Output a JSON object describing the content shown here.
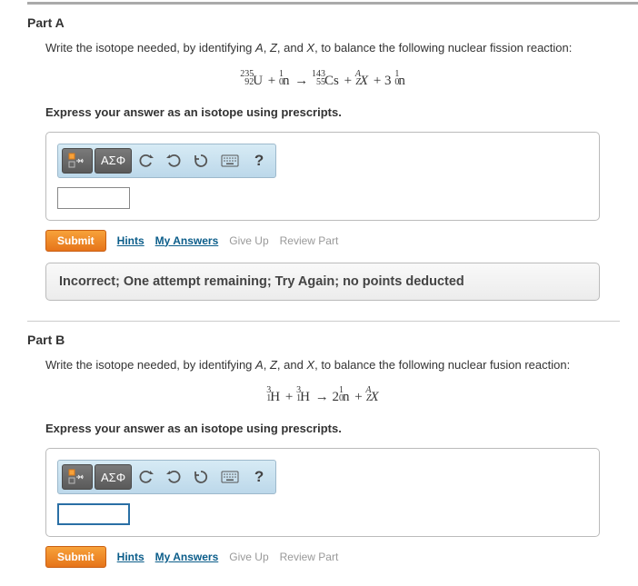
{
  "partA": {
    "header": "Part A",
    "prompt_pre": "Write the isotope needed, by identifying ",
    "prompt_varA": "A",
    "prompt_mid1": ", ",
    "prompt_varZ": "Z",
    "prompt_mid2": ", and ",
    "prompt_varX": "X",
    "prompt_post": ", to balance the following nuclear fission reaction:",
    "eq": {
      "u_top": "235",
      "u_bot": "92",
      "u": "U",
      "plus1": " + ",
      "n1_top": "1",
      "n1_bot": "0",
      "n1": "n",
      "arrow": "→",
      "cs_top": "143",
      "cs_bot": "55",
      "cs": "Cs",
      "plus2": " + ",
      "x_top": "A",
      "x_bot": "Z",
      "x": "X",
      "plus3": " + 3 ",
      "n2_top": "1",
      "n2_bot": "0",
      "n2": "n"
    },
    "instruct": "Express your answer as an isotope using prescripts.",
    "toolbar": {
      "greek_label": "ΑΣΦ"
    },
    "input_value": "",
    "submit": "Submit",
    "hints": "Hints",
    "myanswers": "My Answers",
    "giveup": "Give Up",
    "review": "Review Part",
    "feedback": "Incorrect; One attempt remaining; Try Again; no points deducted"
  },
  "partB": {
    "header": "Part B",
    "prompt_pre": "Write the isotope needed, by identifying ",
    "prompt_varA": "A",
    "prompt_mid1": ", ",
    "prompt_varZ": "Z",
    "prompt_mid2": ", and ",
    "prompt_varX": "X",
    "prompt_post": ", to balance the following nuclear fusion reaction:",
    "eq": {
      "h1_top": "3",
      "h1_bot": "1",
      "h1": "H",
      "plus1": " + ",
      "h2_top": "3",
      "h2_bot": "1",
      "h2": "H",
      "arrow": "→",
      "n_coef": "2",
      "n_top": "1",
      "n_bot": "0",
      "n": "n",
      "plus2": " + ",
      "x_top": "A",
      "x_bot": "Z",
      "x": "X"
    },
    "instruct": "Express your answer as an isotope using prescripts.",
    "toolbar": {
      "greek_label": "ΑΣΦ"
    },
    "input_value": "",
    "submit": "Submit",
    "hints": "Hints",
    "myanswers": "My Answers",
    "giveup": "Give Up",
    "review": "Review Part"
  }
}
